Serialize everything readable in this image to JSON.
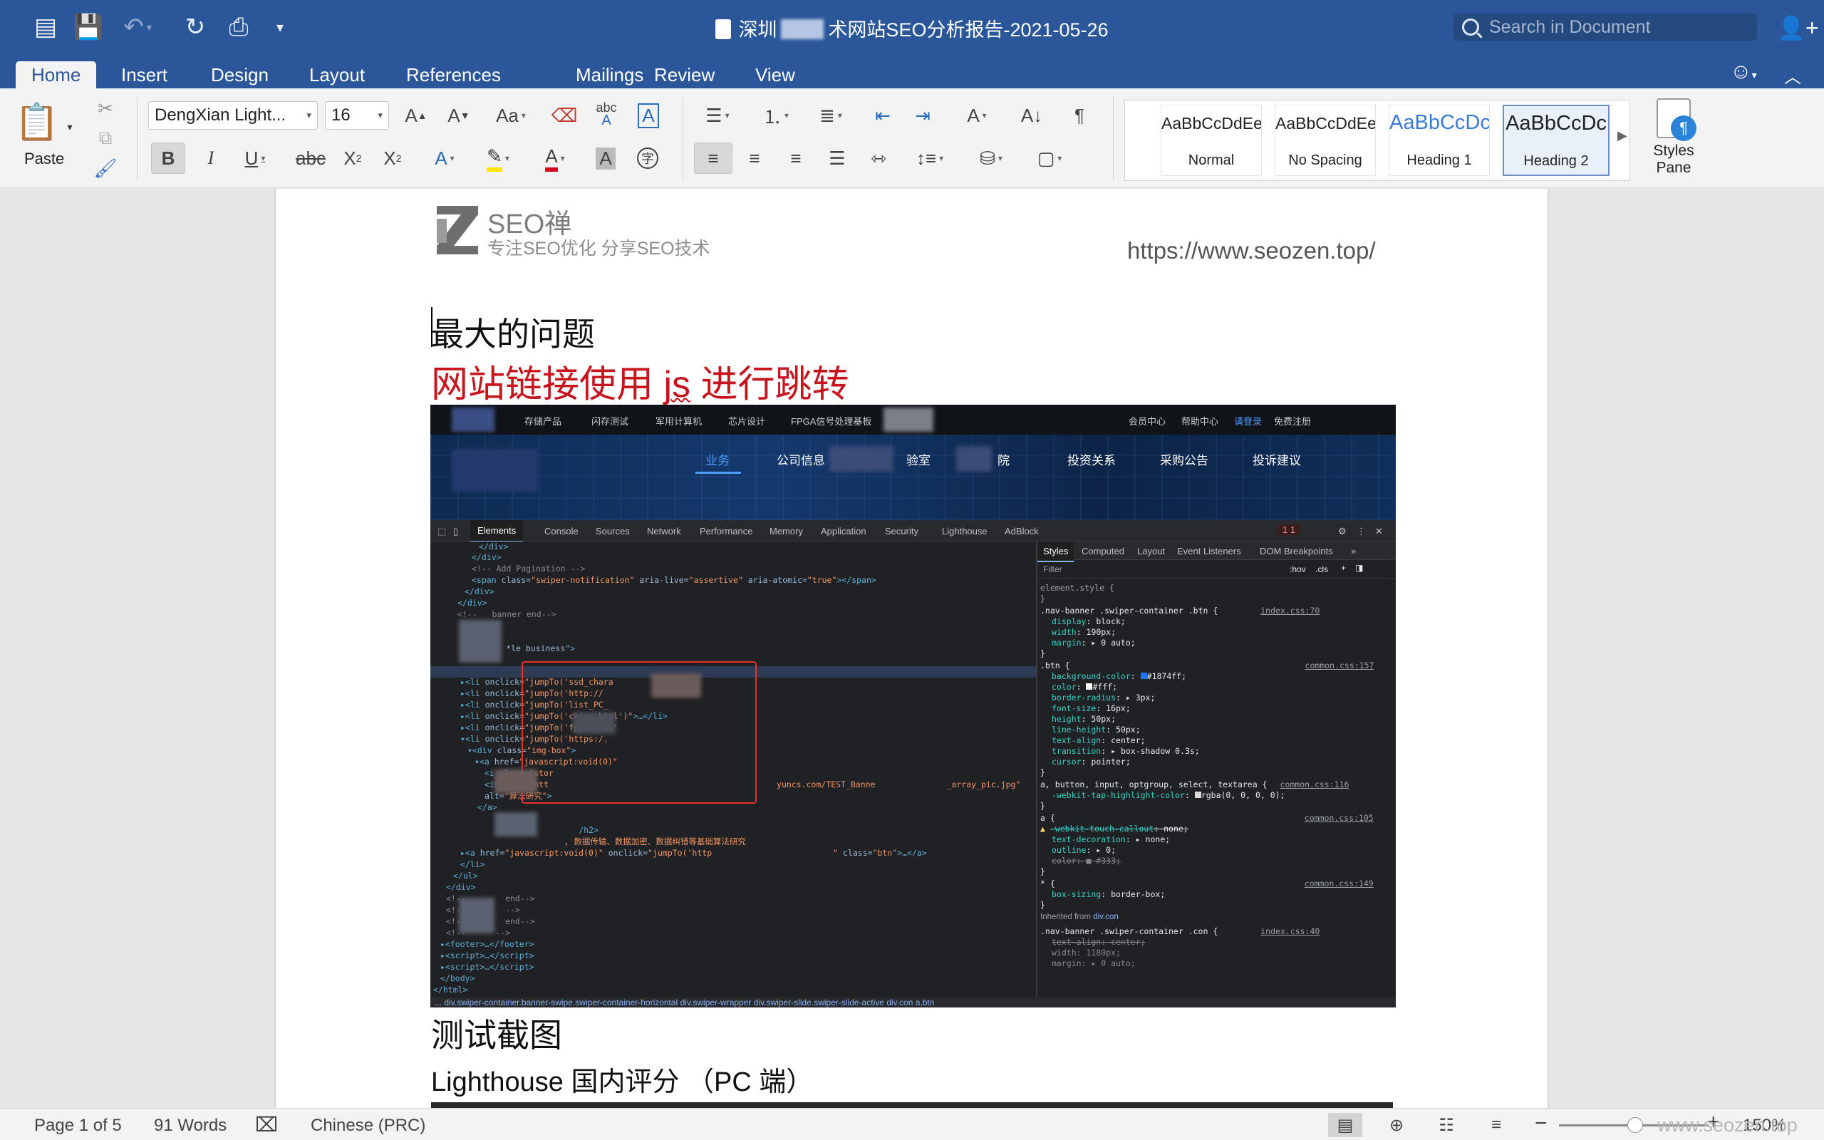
{
  "title_bar": {
    "doc_title_left": "深圳",
    "doc_title_right": "术网站SEO分析报告-2021-05-26",
    "search_placeholder": "Search in Document",
    "icons": [
      "sidebar-icon",
      "save-icon",
      "undo-icon",
      "redo-icon",
      "print-icon",
      "customize-icon",
      "share-icon"
    ]
  },
  "tabs": [
    "Home",
    "Insert",
    "Design",
    "Layout",
    "References",
    "Mailings",
    "Review",
    "View"
  ],
  "active_tab": "Home",
  "ribbon": {
    "paste_label": "Paste",
    "font_name": "DengXian Light...",
    "font_size": "16",
    "styles": [
      {
        "sample": "AaBbCcDdEe",
        "name": "Normal"
      },
      {
        "sample": "AaBbCcDdEe",
        "name": "No Spacing"
      },
      {
        "sample": "AaBbCcDc",
        "name": "Heading 1"
      },
      {
        "sample": "AaBbCcDc",
        "name": "Heading 2"
      }
    ],
    "styles_pane_label": "Styles Pane"
  },
  "document": {
    "logo_title": "SEO禅",
    "logo_sub": "专注SEO优化 分享SEO技术",
    "header_url": "https://www.seozen.top/",
    "heading_problem": "最大的问题",
    "heading_red_a": "网站链接使用 ",
    "heading_red_js": "js",
    "heading_red_b": " 进行跳转",
    "heading_test": "测试截图",
    "heading_lighthouse": "Lighthouse 国内评分 （PC 端）"
  },
  "screenshot": {
    "site_nav": [
      "存储产品",
      "闪存测试",
      "军用计算机",
      "芯片设计",
      "FPGA信号处理基板"
    ],
    "site_nav_right": [
      "会员中心",
      "帮助中心",
      "请登录",
      "免费注册"
    ],
    "banner_nav": [
      "业务",
      "公司信息",
      "验室",
      "院",
      "投资关系",
      "采购公告",
      "投诉建议"
    ],
    "devtools_tabs": [
      "Elements",
      "Console",
      "Sources",
      "Network",
      "Performance",
      "Memory",
      "Application",
      "Security",
      "Lighthouse",
      "AdBlock"
    ],
    "styles_tabs": [
      "Styles",
      "Computed",
      "Layout",
      "Event Listeners",
      "DOM Breakpoints"
    ],
    "filter_placeholder": "Filter",
    "filter_hov": ":hov",
    "filter_cls": ".cls",
    "error_counts": "1  1",
    "breadcrumb": "...  div.swiper-container.banner-swipe.swiper-container-horizontal    div.swiper-wrapper    div.swiper-slide.swiper-slide-active    div.con    a.btn"
  },
  "status_bar": {
    "page": "Page 1 of 5",
    "words": "91 Words",
    "language": "Chinese (PRC)",
    "zoom": "150%",
    "zoom_level_pct": 150
  },
  "watermark": "www.seozen.top"
}
